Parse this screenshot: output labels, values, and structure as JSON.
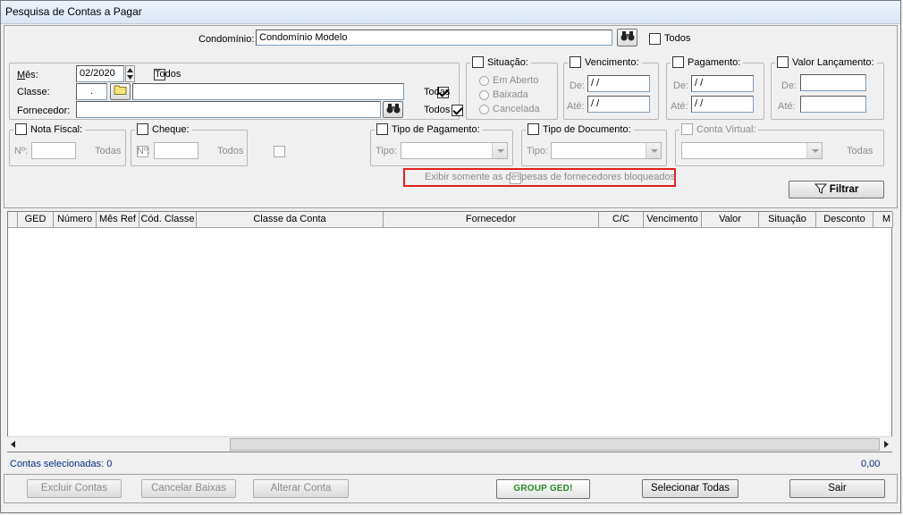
{
  "window": {
    "title": "Pesquisa de Contas a Pagar"
  },
  "condominio": {
    "label": "Condomínio:",
    "value": "Condomínio Modelo",
    "todos_label": "Todos"
  },
  "filtros": {
    "mes_label": "Mês:",
    "mes_value": "02/2020",
    "mes_todos": "Todos",
    "classe_label": "Classe:",
    "classe_code": ".",
    "classe_todas": "Todas",
    "fornecedor_label": "Fornecedor:",
    "fornecedor_todos": "Todos"
  },
  "situacao": {
    "label": "Situação:",
    "opt1": "Em Aberto",
    "opt2": "Baixada",
    "opt3": "Cancelada"
  },
  "vencimento": {
    "label": "Vencimento:",
    "de": "De:",
    "ate": "Até:",
    "de_value": " / /",
    "ate_value": " / /"
  },
  "pagamento": {
    "label": "Pagamento:",
    "de": "De:",
    "ate": "Até:",
    "de_value": " / /",
    "ate_value": " / /"
  },
  "valor_lancamento": {
    "label": "Valor Lançamento:",
    "de": "De:",
    "ate": "Até:"
  },
  "nota_fiscal": {
    "label": "Nota Fiscal:",
    "num": "Nº:",
    "todas": "Todas"
  },
  "cheque": {
    "label": "Cheque:",
    "num": "Nº:",
    "todos": "Todos"
  },
  "tipo_pagamento": {
    "label": "Tipo de Pagamento:",
    "tipo": "Tipo:"
  },
  "tipo_documento": {
    "label": "Tipo de Documento:",
    "tipo": "Tipo:"
  },
  "conta_virtual": {
    "label": "Conta Virtual:",
    "todas": "Todas"
  },
  "bloqueados_label": "Exibir somente as despesas de fornecedores bloqueados",
  "filtrar_label": "Filtrar",
  "grid": {
    "columns": [
      "GED",
      "Número",
      "Mês Ref",
      "Cód. Classe",
      "Classe da Conta",
      "Fornecedor",
      "C/C",
      "Vencimento",
      "Valor",
      "Situação",
      "Desconto",
      "M"
    ]
  },
  "footer": {
    "selecionadas": "Contas selecionadas: 0",
    "total": "0,00",
    "excluir": "Excluir Contas",
    "cancelar": "Cancelar Baixas",
    "alterar": "Alterar Conta",
    "ged_logo": "GROUP GED!",
    "selecionar": "Selecionar Todas",
    "sair": "Sair"
  },
  "colors": {
    "highlight_border": "#e02020",
    "link_text": "#0b2e7a"
  }
}
